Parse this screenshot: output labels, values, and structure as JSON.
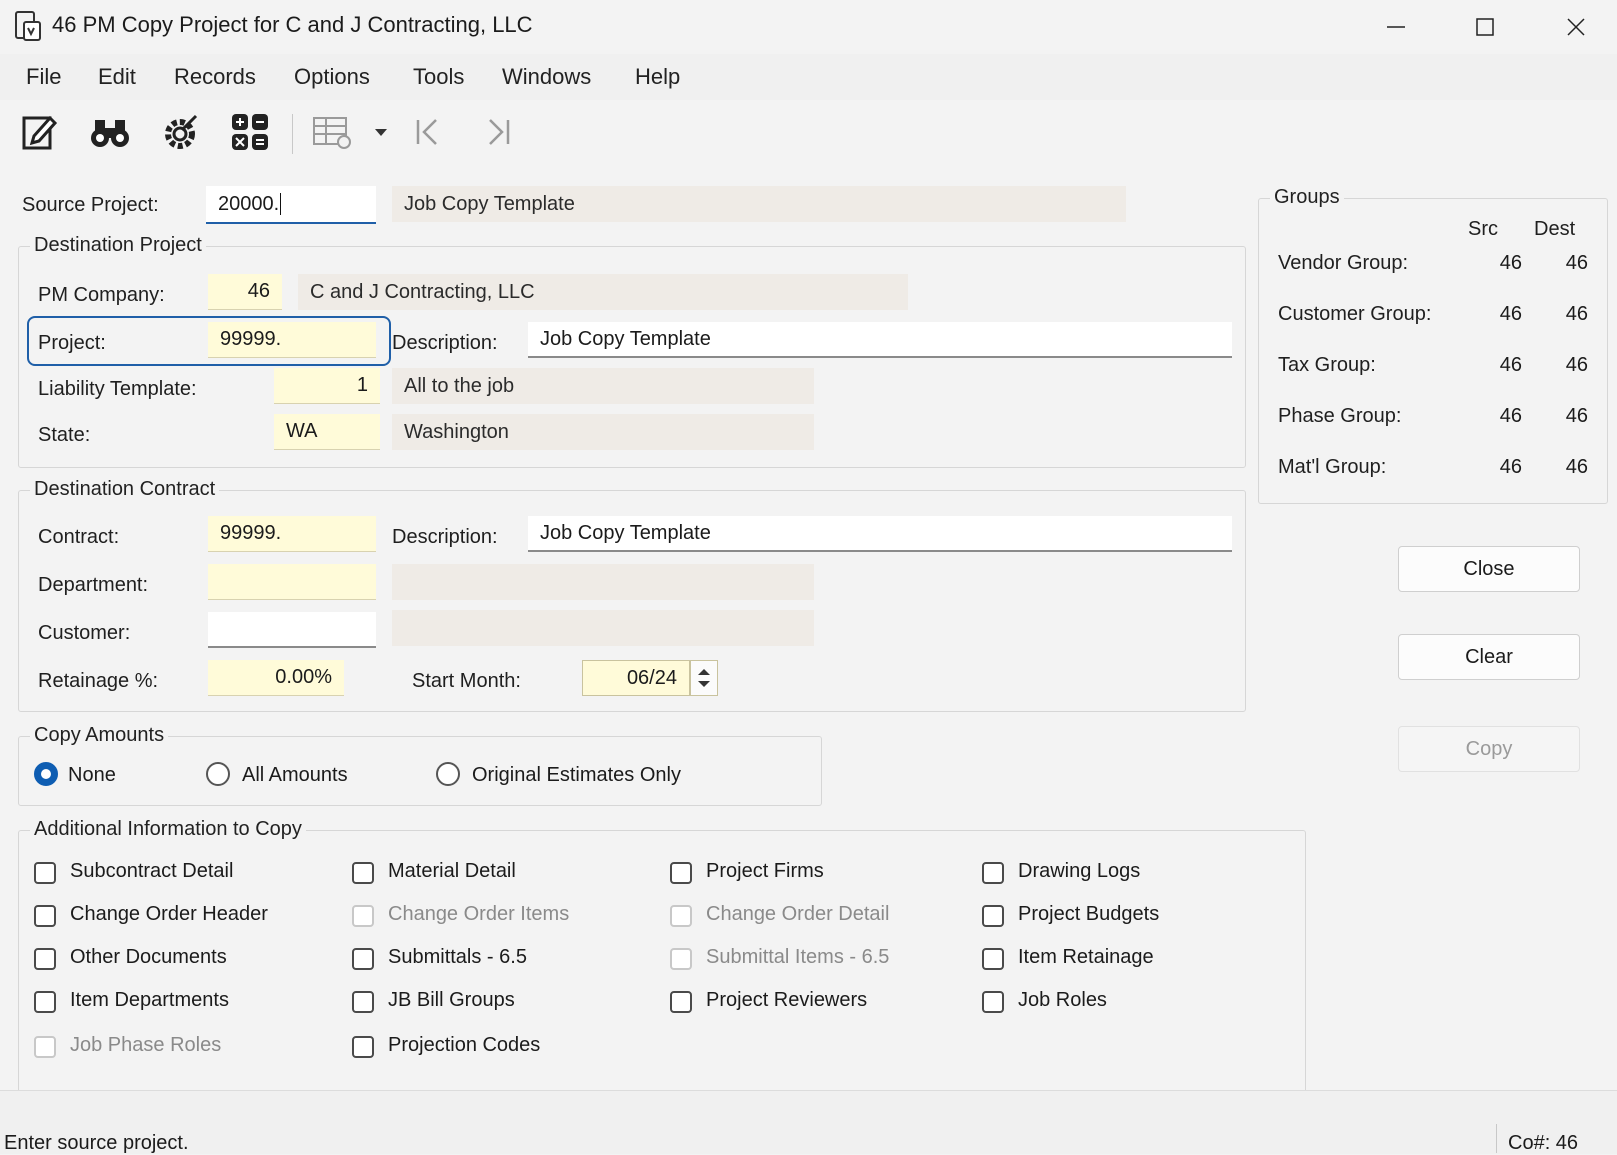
{
  "window": {
    "title": "46 PM Copy Project for C and J Contracting, LLC"
  },
  "menu": [
    "File",
    "Edit",
    "Records",
    "Options",
    "Tools",
    "Windows",
    "Help"
  ],
  "toolbar": {
    "icons": [
      "edit-icon",
      "find-icon",
      "settings-icon",
      "calculator-icon",
      "grid-settings-icon",
      "first-record-icon",
      "last-record-icon"
    ]
  },
  "source": {
    "label": "Source Project:",
    "value": "20000.",
    "description": "Job Copy Template"
  },
  "dest_project": {
    "title": "Destination Project",
    "company_label": "PM Company:",
    "company_value": "46",
    "company_name": "C and J Contracting, LLC",
    "project_label": "Project:",
    "project_value": "99999.",
    "desc_label": "Description:",
    "desc_value": "Job Copy Template",
    "liability_label": "Liability Template:",
    "liability_value": "1",
    "liability_desc": "All to the job",
    "state_label": "State:",
    "state_value": "WA",
    "state_name": "Washington"
  },
  "dest_contract": {
    "title": "Destination Contract",
    "contract_label": "Contract:",
    "contract_value": "99999.",
    "desc_label": "Description:",
    "desc_value": "Job Copy Template",
    "dept_label": "Department:",
    "dept_value": "",
    "dept_desc": "",
    "customer_label": "Customer:",
    "customer_value": "",
    "customer_desc": "",
    "retainage_label": "Retainage %:",
    "retainage_value": "0.00%",
    "start_label": "Start Month:",
    "start_value": "06/24"
  },
  "groups": {
    "title": "Groups",
    "src_header": "Src",
    "dest_header": "Dest",
    "rows": [
      {
        "label": "Vendor Group:",
        "src": "46",
        "dest": "46"
      },
      {
        "label": "Customer Group:",
        "src": "46",
        "dest": "46"
      },
      {
        "label": "Tax Group:",
        "src": "46",
        "dest": "46"
      },
      {
        "label": "Phase Group:",
        "src": "46",
        "dest": "46"
      },
      {
        "label": "Mat'l Group:",
        "src": "46",
        "dest": "46"
      }
    ]
  },
  "buttons": {
    "close": "Close",
    "clear": "Clear",
    "copy": "Copy"
  },
  "copy_amounts": {
    "title": "Copy Amounts",
    "options": [
      "None",
      "All Amounts",
      "Original Estimates Only"
    ],
    "selected": "None"
  },
  "additional": {
    "title": "Additional Information to Copy",
    "items": [
      {
        "label": "Subcontract Detail",
        "checked": false,
        "enabled": true
      },
      {
        "label": "Material Detail",
        "checked": false,
        "enabled": true
      },
      {
        "label": "Project Firms",
        "checked": false,
        "enabled": true
      },
      {
        "label": "Drawing Logs",
        "checked": false,
        "enabled": true
      },
      {
        "label": "Change Order Header",
        "checked": false,
        "enabled": true
      },
      {
        "label": "Change Order Items",
        "checked": false,
        "enabled": false
      },
      {
        "label": "Change Order Detail",
        "checked": false,
        "enabled": false
      },
      {
        "label": "Project Budgets",
        "checked": false,
        "enabled": true
      },
      {
        "label": "Other Documents",
        "checked": false,
        "enabled": true
      },
      {
        "label": "Submittals - 6.5",
        "checked": false,
        "enabled": true
      },
      {
        "label": "Submittal Items - 6.5",
        "checked": false,
        "enabled": false
      },
      {
        "label": "Item Retainage",
        "checked": false,
        "enabled": true
      },
      {
        "label": "Item Departments",
        "checked": false,
        "enabled": true
      },
      {
        "label": "JB Bill Groups",
        "checked": false,
        "enabled": true
      },
      {
        "label": "Project Reviewers",
        "checked": false,
        "enabled": true
      },
      {
        "label": "Job Roles",
        "checked": false,
        "enabled": true
      },
      {
        "label": "Job Phase Roles",
        "checked": false,
        "enabled": false
      },
      {
        "label": "Projection Codes",
        "checked": false,
        "enabled": true
      }
    ]
  },
  "status": {
    "message": "Enter source project.",
    "company": "Co#: 46"
  },
  "colors": {
    "accent": "#0e5db2",
    "required_field": "#fffbd9",
    "readonly_field": "#efebe6",
    "focus_outline": "#1f5fa8"
  }
}
